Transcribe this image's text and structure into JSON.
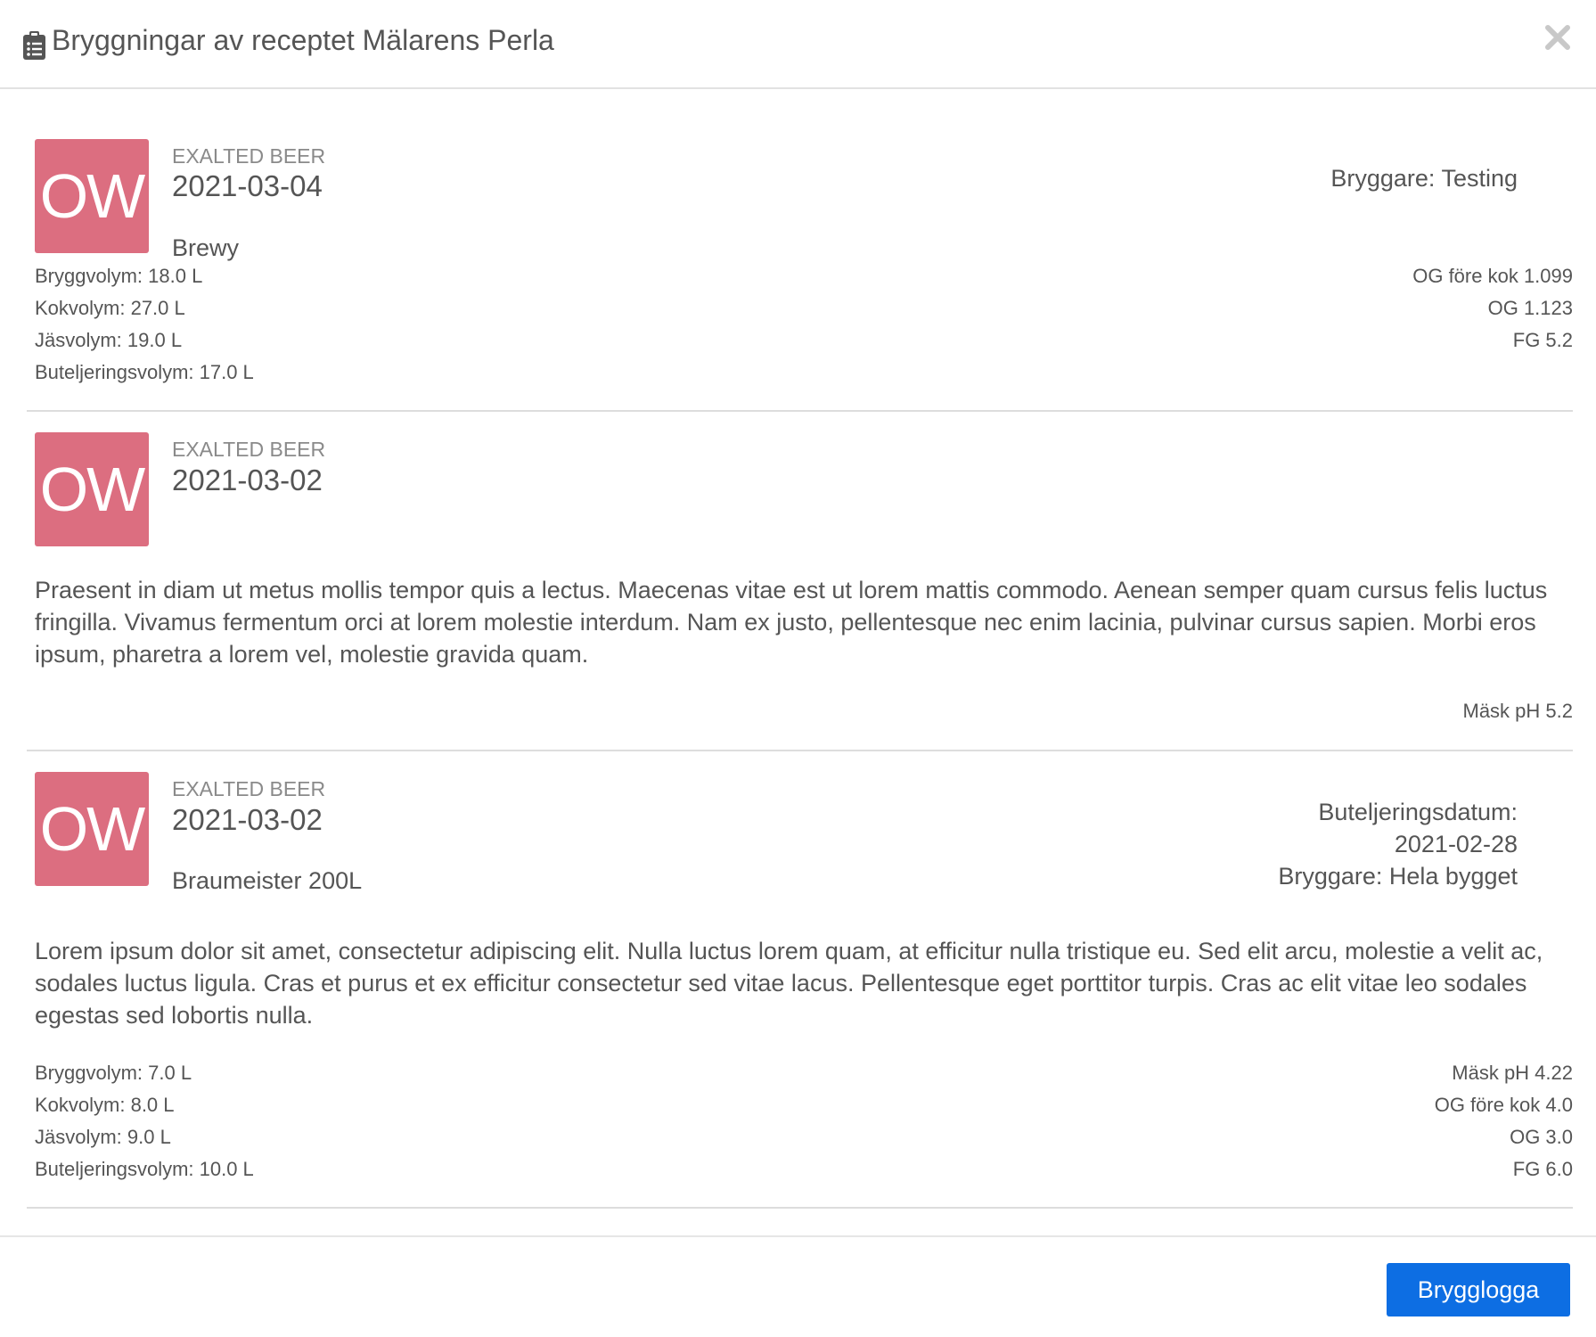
{
  "modal": {
    "title": "Bryggningar av receptet Mälarens Perla",
    "icon": "clipboard-list-icon",
    "close_icon": "close-icon"
  },
  "brews": [
    {
      "avatar_initials": "OW",
      "avatar_color": "#dc6e80",
      "brewery": "EXALTED BEER",
      "date": "2021-03-04",
      "equipment": "Brewy",
      "brewer": "Bryggare: Testing",
      "volumes": [
        "Bryggvolym: 18.0 L",
        "Kokvolym: 27.0 L",
        "Jäsvolym: 19.0 L",
        "Buteljeringsvolym: 17.0 L"
      ],
      "gravities": [
        "OG före kok 1.099",
        "OG 1.123",
        "FG 5.2"
      ]
    },
    {
      "avatar_initials": "OW",
      "avatar_color": "#dc6e80",
      "brewery": "EXALTED BEER",
      "date": "2021-03-02",
      "note": "Praesent in diam ut metus mollis tempor quis a lectus. Maecenas vitae est ut lorem mattis commodo. Aenean semper quam cursus felis luctus fringilla. Vivamus fermentum orci at lorem molestie interdum. Nam ex justo, pellentesque nec enim lacinia, pulvinar cursus sapien. Morbi eros ipsum, pharetra a lorem vel, molestie gravida quam.",
      "mash_ph": "Mäsk pH 5.2"
    },
    {
      "avatar_initials": "OW",
      "avatar_color": "#dc6e80",
      "brewery": "EXALTED BEER",
      "date": "2021-03-02",
      "equipment": "Braumeister 200L",
      "bottling_label": "Buteljeringsdatum:",
      "bottling_date": "2021-02-28",
      "brewer": "Bryggare: Hela bygget",
      "note": "Lorem ipsum dolor sit amet, consectetur adipiscing elit. Nulla luctus lorem quam, at efficitur nulla tristique eu. Sed elit arcu, molestie a velit ac, sodales luctus ligula. Cras et purus et ex efficitur consectetur sed vitae lacus. Pellentesque eget porttitor turpis. Cras ac elit vitae leo sodales egestas sed lobortis nulla.",
      "volumes": [
        "Bryggvolym: 7.0 L",
        "Kokvolym: 8.0 L",
        "Jäsvolym: 9.0 L",
        "Buteljeringsvolym: 10.0 L"
      ],
      "gravities": [
        "Mäsk pH 4.22",
        "OG före kok 4.0",
        "OG 3.0",
        "FG 6.0"
      ]
    }
  ],
  "footer": {
    "log_button_label": "Brygglogga",
    "log_button_color": "#0d6ee3"
  }
}
